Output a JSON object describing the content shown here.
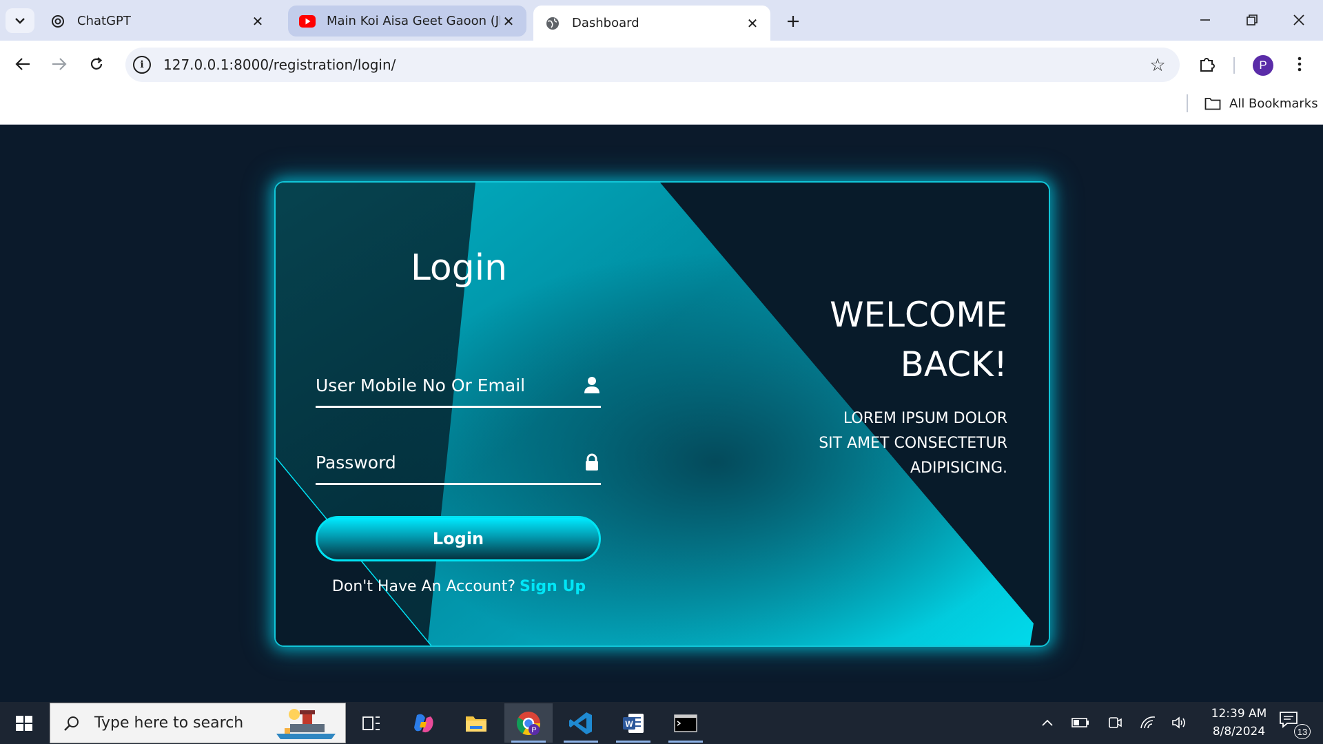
{
  "browser": {
    "tabs": [
      {
        "title": "ChatGPT",
        "icon": "chatgpt-icon"
      },
      {
        "title": "Main Koi Aisa Geet Gaoon (Jha",
        "icon": "youtube-icon"
      },
      {
        "title": "Dashboard",
        "icon": "globe-icon",
        "active": true
      }
    ],
    "url": "127.0.0.1:8000/registration/login/",
    "profile_initial": "P",
    "bookmarks_label": "All Bookmarks"
  },
  "page": {
    "login_title": "Login",
    "username_label": "User Mobile No Or Email",
    "password_label": "Password",
    "login_button": "Login",
    "signup_prompt": "Don't Have An Account?",
    "signup_link": "Sign Up",
    "welcome_line1": "WELCOME",
    "welcome_line2": "BACK!",
    "lorem_line1": "LOREM IPSUM DOLOR",
    "lorem_line2": "SIT AMET CONSECTETUR",
    "lorem_line3": "ADIPISICING.",
    "accent_color": "#00e6f7",
    "background_color": "#0b1a2b"
  },
  "taskbar": {
    "search_placeholder": "Type here to search",
    "time": "12:39 AM",
    "date": "8/8/2024",
    "notification_count": "13",
    "apps": [
      "task-view-icon",
      "copilot-icon",
      "file-explorer-icon",
      "chrome-icon",
      "vscode-icon",
      "word-icon",
      "terminal-icon"
    ]
  }
}
